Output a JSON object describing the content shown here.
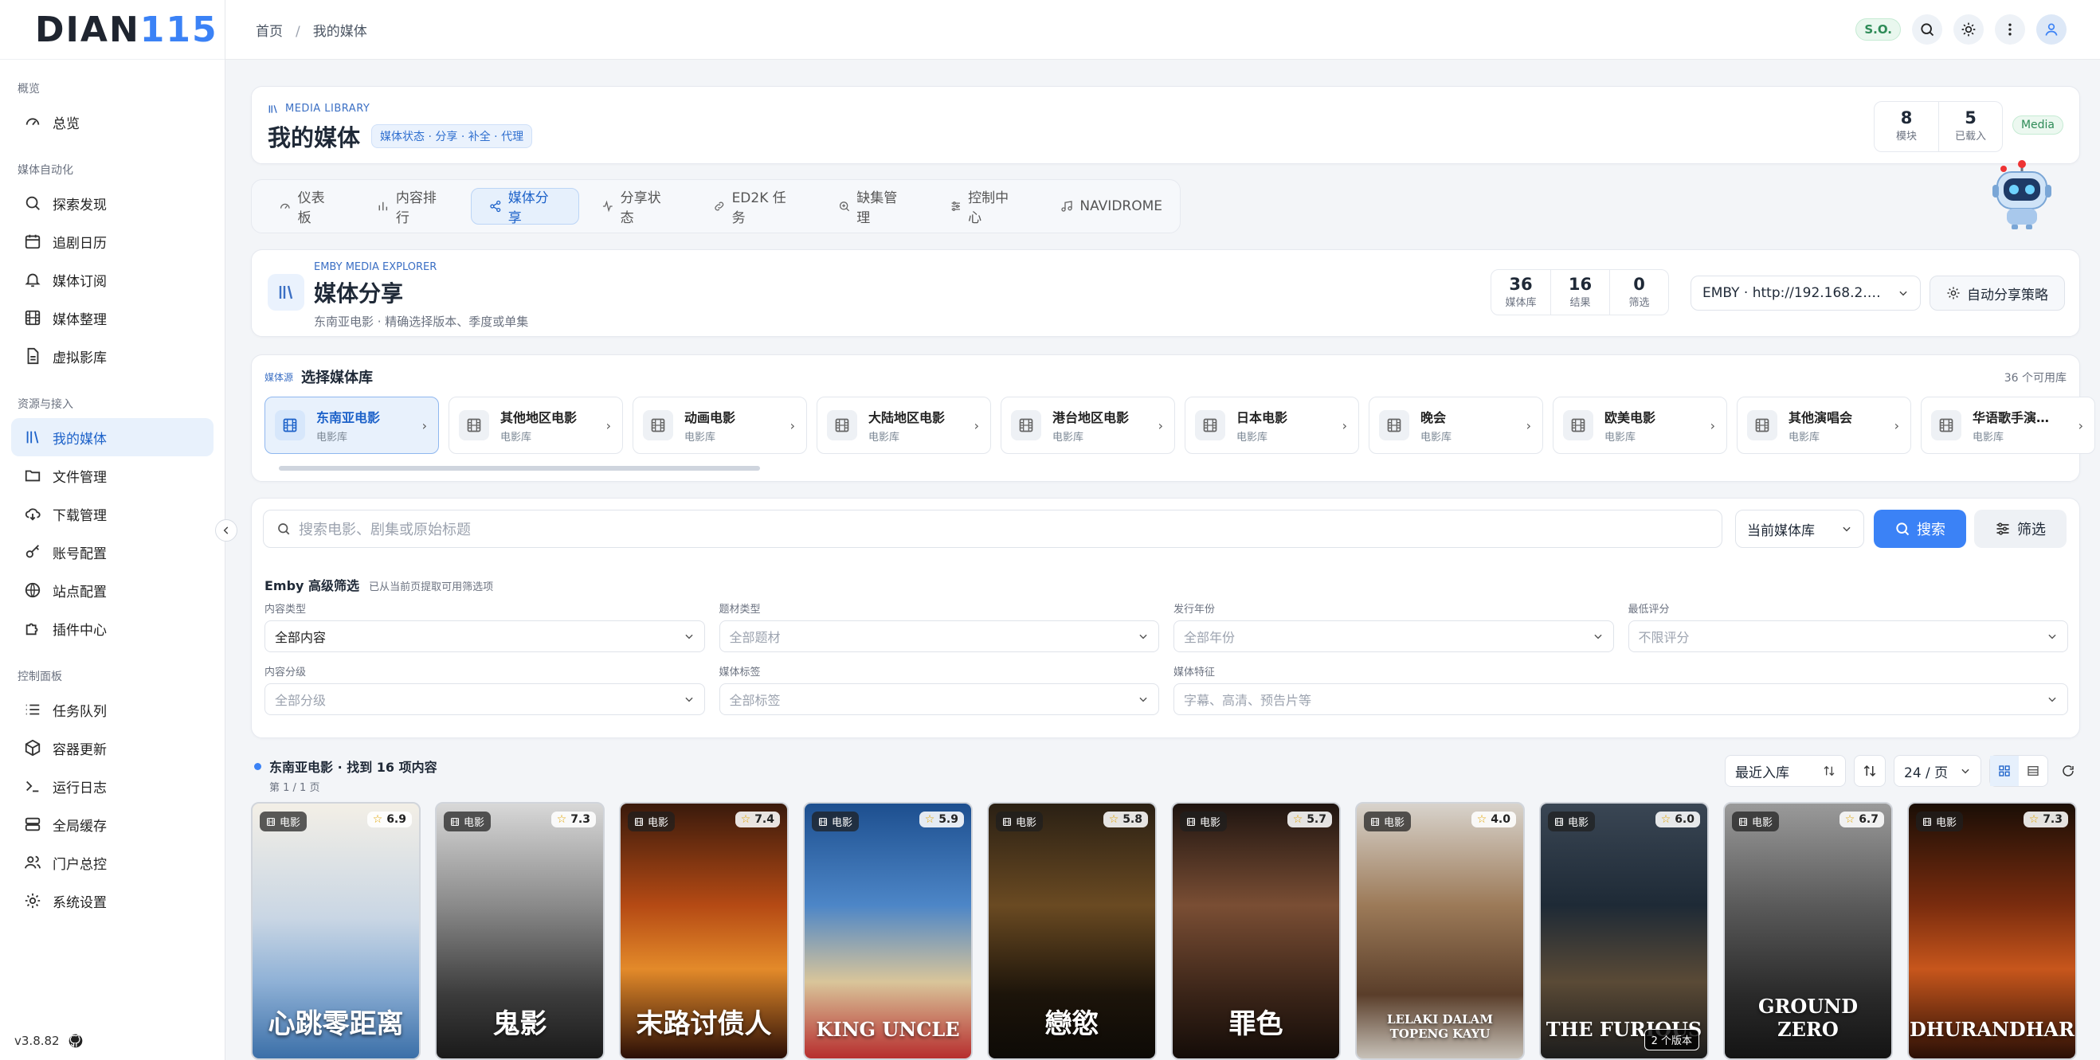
{
  "app": {
    "logo_text": "DIAN",
    "logo_num": "115",
    "version": "v3.8.82"
  },
  "sidebar": {
    "groups": [
      {
        "title": "概览",
        "items": [
          {
            "label": "总览",
            "icon": "gauge-icon"
          }
        ]
      },
      {
        "title": "媒体自动化",
        "items": [
          {
            "label": "探索发现",
            "icon": "search-icon"
          },
          {
            "label": "追剧日历",
            "icon": "calendar-icon"
          },
          {
            "label": "媒体订阅",
            "icon": "bell-icon"
          },
          {
            "label": "媒体整理",
            "icon": "film-icon"
          },
          {
            "label": "虚拟影库",
            "icon": "file-icon"
          }
        ]
      },
      {
        "title": "资源与接入",
        "items": [
          {
            "label": "我的媒体",
            "icon": "library-icon",
            "active": true
          },
          {
            "label": "文件管理",
            "icon": "folder-icon"
          },
          {
            "label": "下载管理",
            "icon": "cloud-download-icon"
          },
          {
            "label": "账号配置",
            "icon": "key-icon"
          },
          {
            "label": "站点配置",
            "icon": "globe-icon"
          },
          {
            "label": "插件中心",
            "icon": "puzzle-icon"
          }
        ]
      },
      {
        "title": "控制面板",
        "items": [
          {
            "label": "任务队列",
            "icon": "list-icon"
          },
          {
            "label": "容器更新",
            "icon": "box-icon"
          },
          {
            "label": "运行日志",
            "icon": "terminal-icon"
          },
          {
            "label": "全局缓存",
            "icon": "database-icon"
          },
          {
            "label": "门户总控",
            "icon": "users-icon"
          },
          {
            "label": "系统设置",
            "icon": "gear-icon"
          }
        ]
      }
    ]
  },
  "topbar": {
    "crumb_home": "首页",
    "crumb_sep": "/",
    "crumb_current": "我的媒体",
    "badge": "S.O."
  },
  "header": {
    "eyebrow": "MEDIA LIBRARY",
    "title": "我的媒体",
    "pill": "媒体状态 · 分享 · 补全 · 代理",
    "stats": [
      {
        "value": "8",
        "label": "模块"
      },
      {
        "value": "5",
        "label": "已载入"
      }
    ],
    "badge": "Media"
  },
  "tabs": [
    {
      "label": "仪表板",
      "icon": "gauge-icon"
    },
    {
      "label": "内容排行",
      "icon": "bar-chart-icon"
    },
    {
      "label": "媒体分享",
      "icon": "share-icon",
      "active": true
    },
    {
      "label": "分享状态",
      "icon": "activity-icon"
    },
    {
      "label": "ED2K 任务",
      "icon": "link-icon"
    },
    {
      "label": "缺集管理",
      "icon": "zoom-icon"
    },
    {
      "label": "控制中心",
      "icon": "sliders-icon"
    },
    {
      "label": "NAVIDROME",
      "icon": "music-icon"
    }
  ],
  "explorer": {
    "eyebrow": "EMBY MEDIA EXPLORER",
    "title": "媒体分享",
    "subtitle": "东南亚电影 · 精确选择版本、季度或单集",
    "stats": [
      {
        "value": "36",
        "label": "媒体库"
      },
      {
        "value": "16",
        "label": "结果"
      },
      {
        "value": "0",
        "label": "筛选"
      }
    ],
    "server": "EMBY · http://192.168.2.…",
    "auto_share": "自动分享策略"
  },
  "libraries": {
    "tag": "媒体源",
    "title": "选择媒体库",
    "count": "36 个可用库",
    "items": [
      {
        "name": "东南亚电影",
        "type": "电影库",
        "active": true
      },
      {
        "name": "其他地区电影",
        "type": "电影库"
      },
      {
        "name": "动画电影",
        "type": "电影库"
      },
      {
        "name": "大陆地区电影",
        "type": "电影库"
      },
      {
        "name": "港台地区电影",
        "type": "电影库"
      },
      {
        "name": "日本电影",
        "type": "电影库"
      },
      {
        "name": "晚会",
        "type": "电影库"
      },
      {
        "name": "欧美电影",
        "type": "电影库"
      },
      {
        "name": "其他演唱会",
        "type": "电影库"
      },
      {
        "name": "华语歌手演…",
        "type": "电影库"
      }
    ]
  },
  "search": {
    "placeholder": "搜索电影、剧集或原始标题",
    "scope": "当前媒体库",
    "search_label": "搜索",
    "filter_label": "筛选"
  },
  "advanced": {
    "title": "Emby 高级筛选",
    "hint": "已从当前页提取可用筛选项",
    "filters": [
      {
        "label": "内容类型",
        "value": "全部内容",
        "placeholder": false
      },
      {
        "label": "题材类型",
        "value": "全部题材",
        "placeholder": true
      },
      {
        "label": "发行年份",
        "value": "全部年份",
        "placeholder": true
      },
      {
        "label": "最低评分",
        "value": "不限评分",
        "placeholder": true
      },
      {
        "label": "内容分级",
        "value": "全部分级",
        "placeholder": true
      },
      {
        "label": "媒体标签",
        "value": "全部标签",
        "placeholder": true
      },
      {
        "label": "媒体特征",
        "value": "字幕、高清、预告片等",
        "placeholder": true
      }
    ]
  },
  "results": {
    "title": "东南亚电影 · 找到 16 项内容",
    "page": "第 1 / 1 页",
    "sort": "最近入库",
    "per_page": "24 / 页"
  },
  "posters": [
    {
      "category": "电影",
      "rating": "6.9",
      "title": "心跳零距离",
      "bg": "linear-gradient(180deg,#f3efe6 0%,#c9d6e4 45%,#8fb1d6 70%,#3b6fa8 100%)"
    },
    {
      "category": "电影",
      "rating": "7.3",
      "title": "鬼影",
      "bg": "linear-gradient(180deg,#d8d8d8 0%,#8a8a8a 40%,#3c3c3c 75%,#1a1a1a 100%)"
    },
    {
      "category": "电影",
      "rating": "7.4",
      "title": "末路讨债人",
      "bg": "linear-gradient(180deg,#3a1a0c 0%,#b54a14 40%,#e38a2a 65%,#2a0e06 100%)"
    },
    {
      "category": "电影",
      "rating": "5.9",
      "title": "KING UNCLE",
      "bg": "linear-gradient(180deg,#1d4f8f 0%,#4d86c7 40%,#d9c59a 70%,#b72e2e 100%)"
    },
    {
      "category": "电影",
      "rating": "5.8",
      "title": "戀慾",
      "bg": "linear-gradient(180deg,#2a2014 0%,#6a4a22 40%,#1c140a 75%,#0d0a06 100%)"
    },
    {
      "category": "电影",
      "rating": "5.7",
      "title": "罪色",
      "bg": "linear-gradient(180deg,#1e1410 0%,#7a4e34 40%,#3a2418 75%,#140c08 100%)"
    },
    {
      "category": "电影",
      "rating": "4.0",
      "title": "LELAKI DALAM TOPENG KAYU",
      "bg": "linear-gradient(180deg,#d8d3cc 0%,#9c7a58 40%,#5a3e2a 75%,#c7c1b8 100%)"
    },
    {
      "category": "电影",
      "rating": "6.0",
      "title": "THE FURIOUS",
      "version": "2 个版本",
      "bg": "linear-gradient(180deg,#3a4654 0%,#1e2a36 40%,#5a4a36 70%,#1c1c1c 100%)"
    },
    {
      "category": "电影",
      "rating": "6.7",
      "title": "GROUND ZERO",
      "bg": "linear-gradient(180deg,#9a9a9a 0%,#5a5a5a 40%,#2a2a2a 75%,#141414 100%)"
    },
    {
      "category": "电影",
      "rating": "7.3",
      "title": "DHURANDHAR",
      "bg": "linear-gradient(180deg,#1a0e06 0%,#7a2c0e 40%,#c7561c 65%,#2a0f06 100%)"
    }
  ]
}
